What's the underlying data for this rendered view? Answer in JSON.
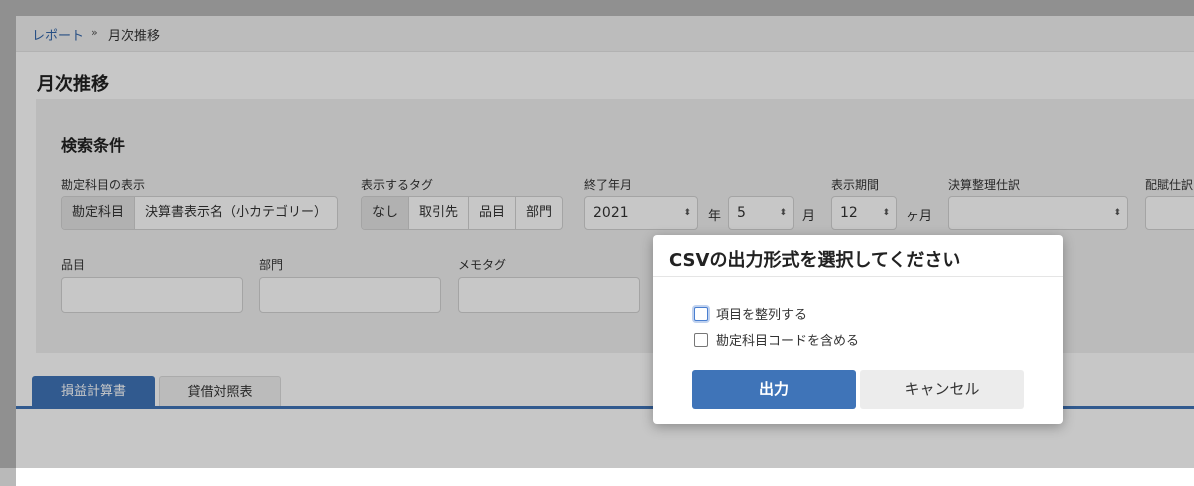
{
  "breadcrumb": {
    "parent": "レポート",
    "separator": "»",
    "current": "月次推移"
  },
  "page_title": "月次推移",
  "search": {
    "heading": "検索条件",
    "account_display": {
      "label": "勘定科目の表示",
      "options": [
        "勘定科目",
        "決算書表示名（小カテゴリー）"
      ]
    },
    "tag_display": {
      "label": "表示するタグ",
      "options": [
        "なし",
        "取引先",
        "品目",
        "部門"
      ]
    },
    "end_month": {
      "label": "終了年月",
      "year": "2021",
      "year_unit": "年",
      "month": "5",
      "month_unit": "月"
    },
    "period": {
      "label": "表示期間",
      "value": "12",
      "unit": "ヶ月"
    },
    "closing_entries": {
      "label": "決算整理仕訳",
      "value": ""
    },
    "allocation_entries": {
      "label": "配賦仕訳"
    },
    "item": {
      "label": "品目"
    },
    "department": {
      "label": "部門"
    },
    "memo_tag": {
      "label": "メモタグ"
    }
  },
  "tabs": [
    {
      "label": "損益計算書",
      "active": true
    },
    {
      "label": "貸借対照表",
      "active": false
    }
  ],
  "modal": {
    "title": "CSVの出力形式を選択してください",
    "options": [
      {
        "label": "項目を整列する",
        "checked": false
      },
      {
        "label": "勘定科目コードを含める",
        "checked": false
      }
    ],
    "primary_button": "出力",
    "cancel_button": "キャンセル"
  },
  "colors": {
    "accent": "#3f74b8",
    "link": "#3366aa",
    "overlay": "rgba(0,0,0,0.22)"
  },
  "icons": {
    "select_arrows": "up-down-arrows-icon"
  }
}
